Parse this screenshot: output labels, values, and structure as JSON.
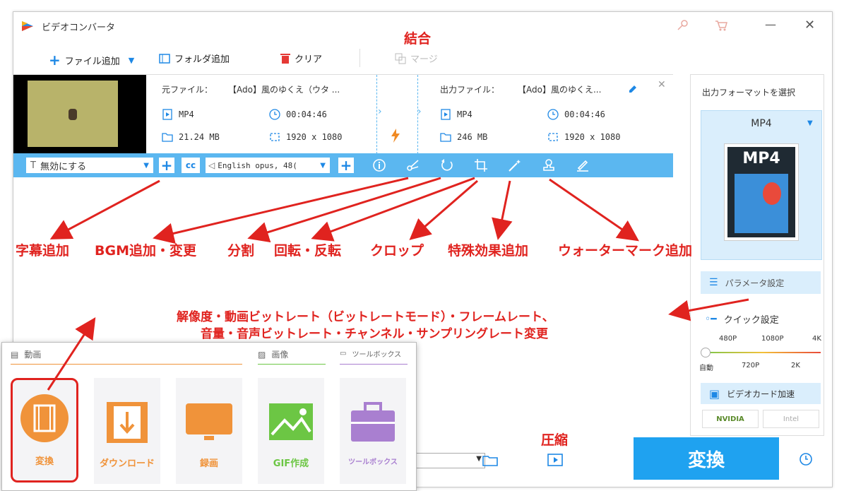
{
  "window": {
    "title": "ビデオコンバータ"
  },
  "toolbar": {
    "add_file": "ファイル追加",
    "add_folder": "フォルダ追加",
    "clear": "クリア",
    "merge": "マージ"
  },
  "file": {
    "source_label": "元ファイル：",
    "source_name": "【Ado】風のゆくえ（ウタ ...",
    "output_label": "出力ファイル：",
    "output_name": "【Ado】風のゆくえ...",
    "src_format": "MP4",
    "src_duration": "00:04:46",
    "src_size": "21.24 MB",
    "src_res": "1920 x 1080",
    "out_format": "MP4",
    "out_duration": "00:04:46",
    "out_size": "246 MB",
    "out_res": "1920 x 1080"
  },
  "subbar": {
    "subtitle_select": "無効にする",
    "audio_select": "English opus, 48("
  },
  "right_panel": {
    "format_title": "出力フォーマットを選択",
    "format_value": "MP4",
    "format_icon_text": "MP4",
    "param_button": "パラメータ設定",
    "quick_setting": "クイック設定",
    "quality_top": [
      "480P",
      "1080P",
      "4K"
    ],
    "quality_bottom": [
      "自動",
      "720P",
      "2K"
    ],
    "gpu_label": "ビデオカード加速",
    "nvidia": "NVIDIA",
    "intel": "Intel"
  },
  "convert_button": "変換",
  "annotations": {
    "merge": "結合",
    "subtitle": "字幕追加",
    "bgm": "BGM追加・変更",
    "split": "分割",
    "rotate": "回転・反転",
    "crop": "クロップ",
    "effect": "特殊効果追加",
    "watermark": "ウォーターマーク追加",
    "params_line1": "解像度・動画ビットレート（ビットレートモード）・フレームレート、",
    "params_line2": "音量・音声ビットレート・チャンネル・サンプリングレート変更",
    "compress": "圧縮"
  },
  "popup": {
    "section_video": "動画",
    "section_image": "画像",
    "section_tools": "ツールボックス",
    "cards": [
      "変換",
      "ダウンロード",
      "録画",
      "GIF作成",
      "ツールボックス"
    ]
  },
  "colors": {
    "accent": "#1fa2f0",
    "subbar": "#5bb7f0",
    "annotation": "#e0231f",
    "card_orange": "#f0933a",
    "card_green": "#6cc644",
    "card_purple": "#a97fd0"
  }
}
